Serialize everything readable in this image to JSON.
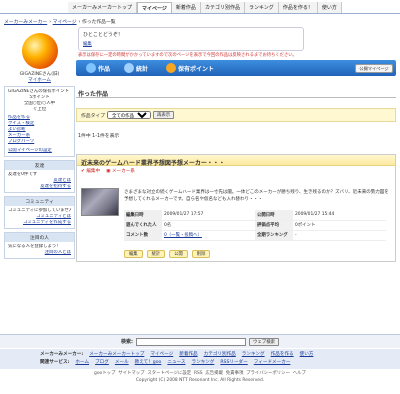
{
  "nav": {
    "tabs": [
      "メーカーみメーカートップ",
      "マイページ",
      "新着作品",
      "カテゴリ別作品",
      "ランキング",
      "作品を作る！",
      "使い方"
    ],
    "active_index": 1
  },
  "breadcrumb": [
    "メーカーみメーカー",
    "マイページ",
    "作った作品一覧"
  ],
  "sidebar": {
    "username": "GIGAZINEさん(旧)",
    "mypage_link": "マイホーム",
    "points_box": {
      "lines": [
        "GIGAZINEさんの保有ポイント",
        "5ポイント",
        "全国○位/○人中",
        "ぐ上位"
      ],
      "links": [
        "作品を作る",
        "クイズ・検定",
        "よい診断",
        "メーカー系",
        "ブログパーツ"
      ],
      "settings_link": "公開マイページの設定"
    },
    "friends": {
      "title": "友達",
      "empty": "友達を0件です",
      "links": [
        "友達とは",
        "友達を招待する"
      ]
    },
    "community": {
      "title": "コミュニティ",
      "empty": "コミュニティに参加していません",
      "links": [
        "コミュニティとは",
        "コミュニティを作成する"
      ]
    },
    "watched": {
      "title": "注目の人",
      "empty": "気になる人を登録しよう！",
      "links": [
        "注目の人とは"
      ]
    }
  },
  "message": {
    "title": "ひとことどうぞ！",
    "edit": "編集"
  },
  "warning": "表示は保存に一定の時間がかかっていますので次のページを表示で今回の作品は反映されるまでお待ちください。",
  "tab_band": {
    "tabs": [
      "作品",
      "統計",
      "保有ポイント"
    ],
    "publish_button": "公開マイページ"
  },
  "page_title": "作った作品",
  "filter": {
    "label": "作品タイプ",
    "selected": "全ての作品",
    "button": "再表示"
  },
  "count": "1件中 1-1件を表示",
  "work": {
    "title": "近未来のゲームハード業界予想図予想メーカー・・・",
    "tags": [
      "編集中",
      "メーカー系"
    ],
    "description": "さまざまな対立の続くゲームハード業界は一寸先は闇。一体どこのメーカーが勝ち残り、生き残るのか？ズバリ、近未来の勢力図を予想してくれるメーカーです。自ら名や仮名なども入れ替わり・・・",
    "meta": [
      [
        "編集日時",
        "2009/01/27 17:57",
        "公開日時",
        "2009/01/27 15:44"
      ],
      [
        "遊んでくれた人",
        "0名",
        "評価点平均",
        "0ポイント"
      ],
      [
        "コメント数",
        "0（一覧・投稿へ）",
        "全期ランキング",
        "-"
      ]
    ],
    "actions": [
      "編集",
      "統計",
      "公開",
      "削除"
    ]
  },
  "footer": {
    "search_label": "検索:",
    "search_button": "ウェブ検索",
    "row1_label": "メーカーみメーカー:",
    "row1": [
      "メーカーみメーカートップ",
      "マイページ",
      "新着作品",
      "カテゴリ別作品",
      "ランキング",
      "作品を作る",
      "使い方"
    ],
    "row2_label": "関連サービス:",
    "row2": [
      "ホーム",
      "ブログ",
      "メール",
      "教えて！goo",
      "ニュース",
      "ランキング",
      "RSSリーダー",
      "フィードメーカー"
    ],
    "sub": [
      "gooトップ",
      "サイトマップ",
      "スタートページに設定",
      "RSS",
      "広告掲載",
      "免責事項",
      "プライバシーポリシー",
      "ヘルプ"
    ],
    "copyright": "Copyright (C) 2008 NTT Resonant Inc. All Rights Reserved."
  },
  "colors": {
    "band": "#2f78d0",
    "warn": "#d03030",
    "link": "#1a3b9a",
    "highlight": "#fff8d0"
  }
}
